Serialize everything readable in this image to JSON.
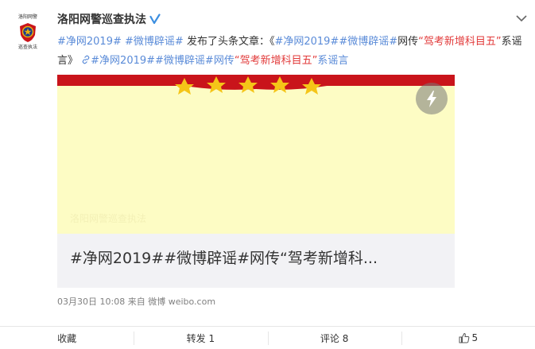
{
  "author": {
    "name": "洛阳网警巡查执法",
    "avatar_text_top": "洛阳网警",
    "avatar_text_bottom": "巡查执法"
  },
  "post": {
    "tag1": "#净网2019#",
    "tag2": "#微博辟谣#",
    "intro": " 发布了头条文章：《",
    "title_tag1": "#净网2019#",
    "title_tag2": "#微博辟谣#",
    "title_mid": "网传",
    "title_quote": "“驾考新增科目五”",
    "title_end": "系谣言》",
    "link_icon": "link-icon",
    "link_tag1": "#净网2019#",
    "link_tag2": "#微博辟谣#",
    "link_mid": "网传",
    "link_quote": "“驾考新增科目五”",
    "link_end": "系谣言"
  },
  "card": {
    "watermark": "洛阳网警巡查执法",
    "title": "#净网2019##微博辟谣#网传“驾考新增科..."
  },
  "meta": {
    "time": "03月30日 10:08",
    "from_label": "来自",
    "source": "微博 weibo.com"
  },
  "actions": {
    "collect": "收藏",
    "repost": "转发 1",
    "comment": "评论 8",
    "like": "5"
  },
  "colors": {
    "tag": "#5a8bd8",
    "highlight": "#e23b3b",
    "card_bg": "#fdfcc4",
    "banner": "#c9141b"
  }
}
